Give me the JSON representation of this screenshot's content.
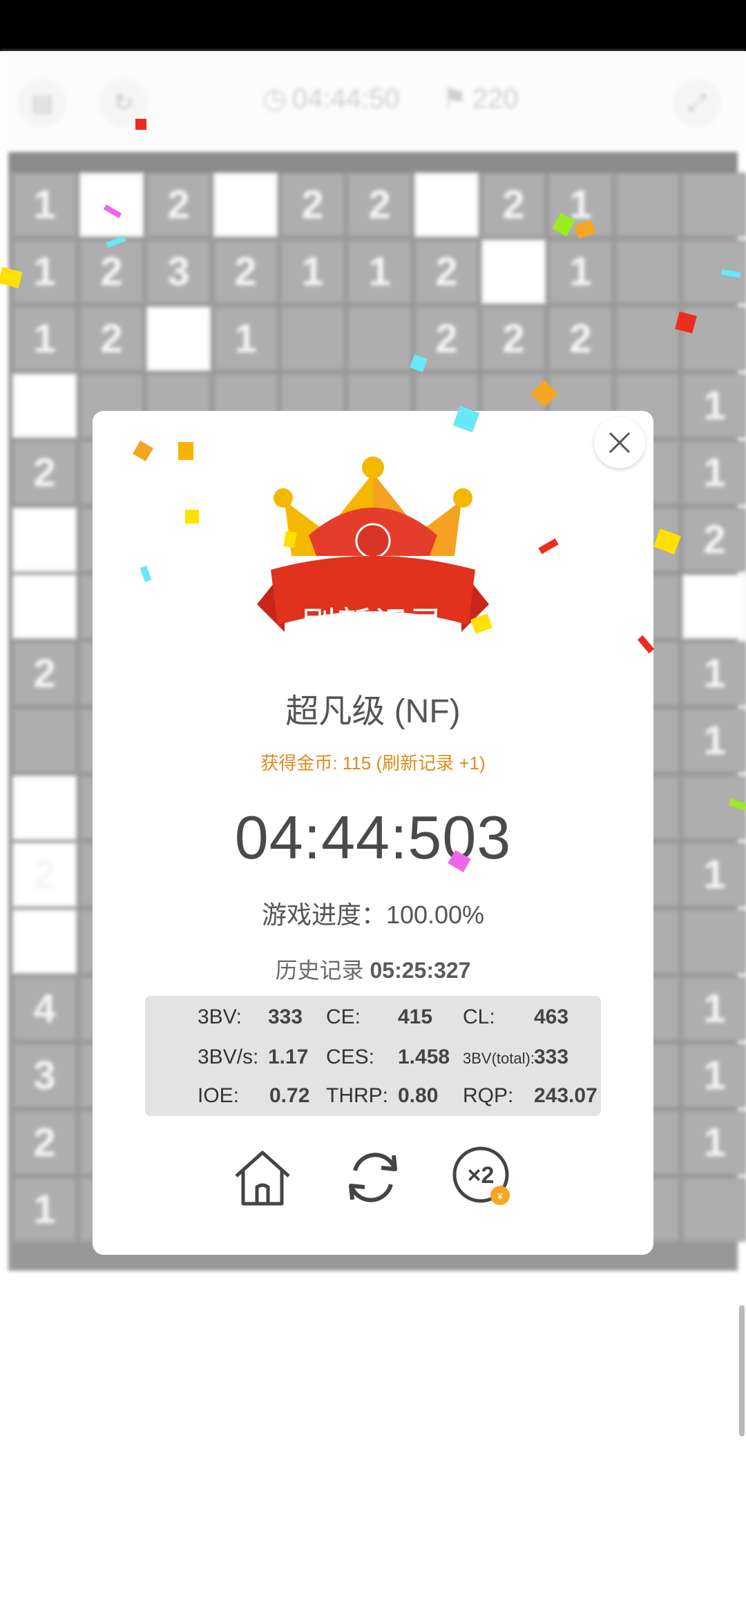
{
  "toolbar": {
    "timer": "04:44:50",
    "flags": "220"
  },
  "board_numbers": [
    "1",
    "",
    "2",
    "",
    "2",
    "2",
    "",
    "2",
    "1",
    "",
    "",
    "1",
    "2",
    "3",
    "2",
    "1",
    "1",
    "2",
    "",
    "1",
    "",
    "",
    "1",
    "2",
    "",
    "1",
    "",
    "",
    "2",
    "2",
    "2",
    "",
    "",
    "",
    "",
    "",
    "",
    "",
    "",
    "",
    "",
    "",
    "",
    "1",
    "2",
    "",
    "",
    "",
    "",
    "",
    "",
    "",
    "",
    "",
    "1",
    "",
    "",
    "",
    "",
    "",
    "",
    "",
    "",
    "",
    "",
    "2",
    "",
    "",
    "",
    "",
    "",
    "",
    "",
    "",
    "",
    "",
    "",
    "2",
    "",
    "",
    "",
    "",
    "",
    "",
    "",
    "",
    "",
    "1",
    "",
    "",
    "",
    "",
    "",
    "",
    "",
    "",
    "",
    "",
    "1",
    "",
    "",
    "",
    "",
    "",
    "",
    "",
    "",
    "",
    "",
    "",
    "2",
    "",
    "",
    "",
    "",
    "",
    "",
    "",
    "",
    "",
    "1",
    "",
    "",
    "",
    "",
    "",
    "",
    "",
    "",
    "",
    "",
    "",
    "4",
    "",
    "",
    "",
    "",
    "",
    "",
    "",
    "",
    "",
    "1",
    "3",
    "",
    "",
    "",
    "",
    "",
    "",
    "",
    "",
    "",
    "1",
    "2",
    "",
    "",
    "",
    "",
    "",
    "",
    "",
    "",
    "",
    "1",
    "1",
    "",
    "",
    "",
    "",
    "",
    "",
    "",
    "",
    "",
    ""
  ],
  "dialog": {
    "badge": "刷新记录",
    "level": "超凡级 (NF)",
    "coins": "获得金币: 115 (刷新记录 +1)",
    "time": "04:44:503",
    "progress": "游戏进度：100.00%",
    "history_label": "历史记录",
    "history_value": "05:25:327",
    "stats": {
      "bv_label": "3BV:",
      "bv": "333",
      "ce_label": "CE:",
      "ce": "415",
      "cl_label": "CL:",
      "cl": "463",
      "bvs_label": "3BV/s:",
      "bvs": "1.17",
      "ces_label": "CES:",
      "ces": "1.458",
      "bvtotal_label": "3BV(total):",
      "bvtotal": "333",
      "ioe_label": "IOE:",
      "ioe": "0.72",
      "thrp_label": "THRP:",
      "thrp": "0.80",
      "rqp_label": "RQP:",
      "rqp": "243.07"
    },
    "actions": {
      "home_icon": "home-icon",
      "restart_icon": "restart-icon",
      "double_icon": "x2-coin-icon",
      "double_text": "×2"
    }
  },
  "colors": {
    "accent": "#e08a1e",
    "ribbon": "#e0321c",
    "crown": "#f5b800"
  }
}
